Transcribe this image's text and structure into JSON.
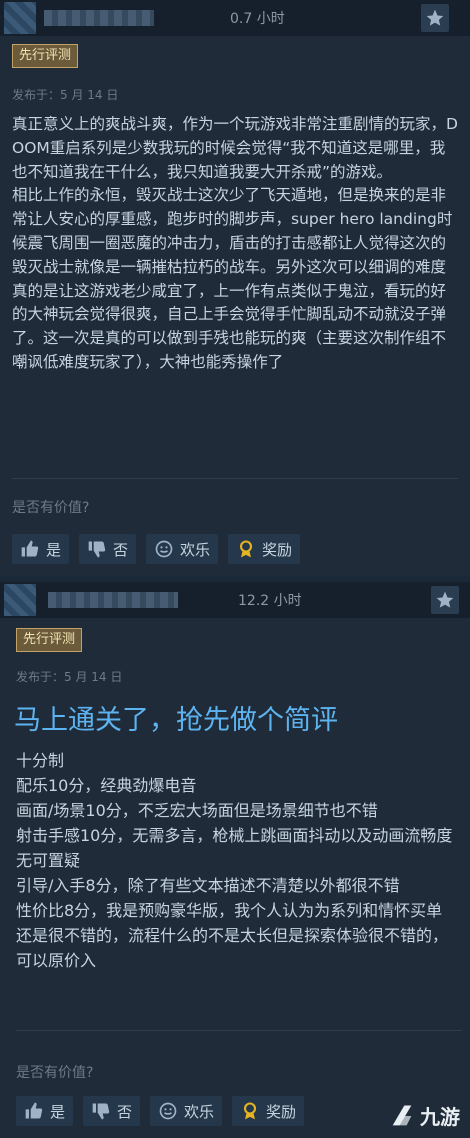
{
  "reviews": [
    {
      "hours": "0.7 小时",
      "badge": "先行评测",
      "posted": "发布于：5 月 14 日",
      "title": "",
      "body": "真正意义上的爽战斗爽，作为一个玩游戏非常注重剧情的玩家，DOOM重启系列是少数我玩的时候会觉得“我不知道这是哪里，我也不知道我在干什么，我只知道我要大开杀戒”的游戏。\n相比上作的永恒，毁灭战士这次少了飞天遁地，但是换来的是非常让人安心的厚重感，跑步时的脚步声，super hero landing时候震飞周围一圈恶魔的冲击力，盾击的打击感都让人觉得这次的毁灭战士就像是一辆摧枯拉朽的战车。另外这次可以细调的难度真的是让这游戏老少咸宜了，上一作有点类似于鬼泣，看玩的好的大神玩会觉得很爽，自己上手会觉得手忙脚乱动不动就没子弹了。这一次是真的可以做到手残也能玩的爽（主要这次制作组不嘲讽低难度玩家了），大神也能秀操作了",
      "helpful_q": "是否有价值?",
      "buttons": {
        "yes": "是",
        "no": "否",
        "funny": "欢乐",
        "award": "奖励"
      }
    },
    {
      "hours": "12.2 小时",
      "badge": "先行评测",
      "posted": "发布于：5 月 14 日",
      "title": "马上通关了，抢先做个简评",
      "body": "十分制\n配乐10分，经典劲爆电音\n画面/场景10分，不乏宏大场面但是场景细节也不错\n射击手感10分，无需多言，枪械上跳画面抖动以及动画流畅度无可置疑\n引导/入手8分，除了有些文本描述不清楚以外都很不错\n性价比8分，我是预购豪华版，我个人认为为系列和情怀买单还是很不错的，流程什么的不是太长但是探索体验很不错的，可以原价入",
      "helpful_q": "是否有价值?",
      "buttons": {
        "yes": "是",
        "no": "否",
        "funny": "欢乐",
        "award": "奖励"
      }
    }
  ],
  "watermark": "九游",
  "icons": [
    "star-icon",
    "thumbs-up-icon",
    "thumbs-down-icon",
    "smiley-icon",
    "award-icon",
    "watermark-logo-icon"
  ],
  "colors": {
    "background": "#1b2838",
    "title": "#5cb3f0",
    "badge_bg": "#6b5b3b",
    "award": "#e6b422"
  }
}
